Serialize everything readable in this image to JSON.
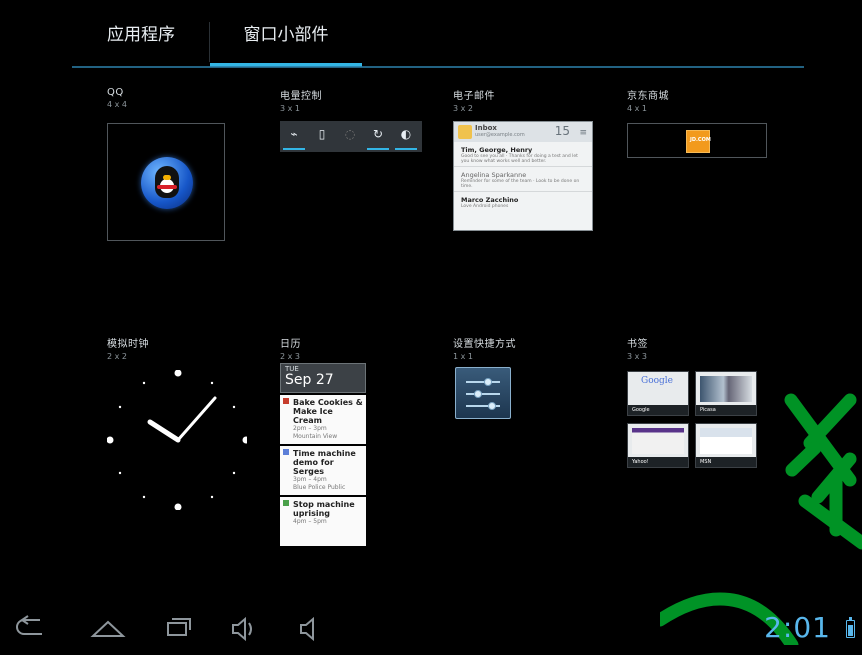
{
  "tabs": {
    "apps": "应用程序",
    "widgets": "窗口小部件",
    "selected": "窗口小部件"
  },
  "widgets": [
    {
      "name": "QQ",
      "size": "4 x 4"
    },
    {
      "name": "电量控制",
      "size": "3 x 1"
    },
    {
      "name": "电子邮件",
      "size": "3 x 2"
    },
    {
      "name": "京东商城",
      "size": "4 x 1"
    },
    {
      "name": "模拟时钟",
      "size": "2 x 2"
    },
    {
      "name": "日历",
      "size": "2 x 3"
    },
    {
      "name": "设置快捷方式",
      "size": "1 x 1"
    },
    {
      "name": "书签",
      "size": "3 x 3"
    }
  ],
  "email_preview": {
    "title": "Inbox",
    "subtitle": "user@example.com",
    "count": "15",
    "messages": [
      {
        "from": "Tim, George, Henry",
        "body": "Good to see you all · Thanks for doing a test and let you know what works well and better.",
        "read": false
      },
      {
        "from": "Angelina Sparkanne",
        "body": "Reminder for some of the team · Look to be done on time.",
        "read": true
      },
      {
        "from": "Marco Zacchino",
        "body": "Love Android phones",
        "read": false
      }
    ]
  },
  "jd_preview": {
    "label": "JD.COM"
  },
  "calendar_preview": {
    "day": "TUE",
    "date": "Sep 27",
    "events": [
      {
        "title": "Bake Cookies & Make Ice Cream",
        "time": "2pm – 3pm",
        "location": "Mountain View",
        "color": "#c63c2c"
      },
      {
        "title": "Time machine demo for Serges",
        "time": "3pm – 4pm",
        "location": "Blue Police Public",
        "color": "#5c7fd8"
      },
      {
        "title": "Stop machine uprising",
        "time": "4pm – 5pm",
        "location": "",
        "color": "#4aa04a"
      }
    ]
  },
  "bookmarks_preview": [
    "Google",
    "Picasa",
    "Yahoo!",
    "MSN"
  ],
  "status": {
    "time": "2:01"
  },
  "colors": {
    "accent": "#33b5e5",
    "clock": "#59b7ec",
    "watermark": "#009b28"
  }
}
